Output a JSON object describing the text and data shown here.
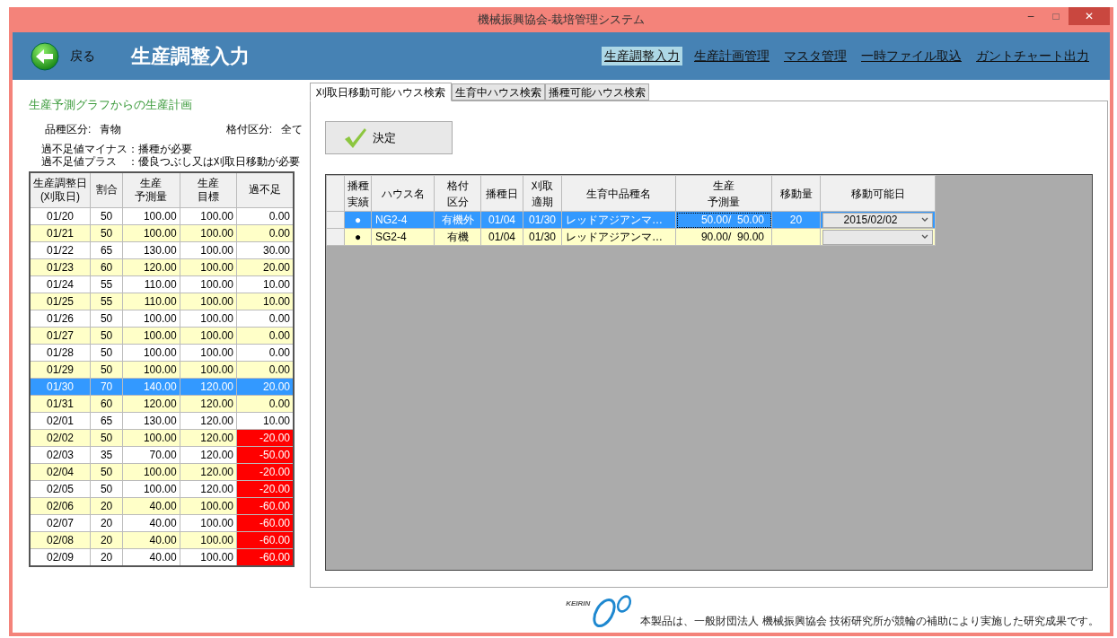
{
  "window": {
    "title": "機械振興協会-栽培管理システム",
    "controls": [
      "–",
      "□",
      "✕"
    ]
  },
  "header": {
    "back_label": "戻る",
    "title": "生産調整入力",
    "nav": [
      {
        "label": "生産調整入力",
        "selected": true
      },
      {
        "label": "生産計画管理",
        "selected": false
      },
      {
        "label": "マスタ管理",
        "selected": false
      },
      {
        "label": "一時ファイル取込",
        "selected": false
      },
      {
        "label": "ガントチャート出力",
        "selected": false
      }
    ]
  },
  "left_panel": {
    "heading": "生産予測グラフからの生産計画",
    "variety_label": "品種区分:",
    "variety_value": "青物",
    "grade_label": "格付区分:",
    "grade_value": "全て",
    "notes": [
      "過不足値マイナス：播種が必要",
      "過不足値プラス　：優良つぶし又は刈取日移動が必要"
    ],
    "table": {
      "columns": [
        {
          "line_1": "生産調整日",
          "line_2": "(刈取日)"
        },
        {
          "line_1": "割合"
        },
        {
          "line_1": "生産",
          "line_2": "予測量"
        },
        {
          "line_1": "生産",
          "line_2": "目標"
        },
        {
          "line_1": "過不足"
        }
      ],
      "rows": [
        {
          "cells": [
            "01/20",
            "50",
            "100.00",
            "100.00",
            "0.00"
          ],
          "selected": false,
          "shortage": false
        },
        {
          "cells": [
            "01/21",
            "50",
            "100.00",
            "100.00",
            "0.00"
          ],
          "selected": false,
          "shortage": false
        },
        {
          "cells": [
            "01/22",
            "65",
            "130.00",
            "100.00",
            "30.00"
          ],
          "selected": false,
          "shortage": false
        },
        {
          "cells": [
            "01/23",
            "60",
            "120.00",
            "100.00",
            "20.00"
          ],
          "selected": false,
          "shortage": false
        },
        {
          "cells": [
            "01/24",
            "55",
            "110.00",
            "100.00",
            "10.00"
          ],
          "selected": false,
          "shortage": false
        },
        {
          "cells": [
            "01/25",
            "55",
            "110.00",
            "100.00",
            "10.00"
          ],
          "selected": false,
          "shortage": false
        },
        {
          "cells": [
            "01/26",
            "50",
            "100.00",
            "100.00",
            "0.00"
          ],
          "selected": false,
          "shortage": false
        },
        {
          "cells": [
            "01/27",
            "50",
            "100.00",
            "100.00",
            "0.00"
          ],
          "selected": false,
          "shortage": false
        },
        {
          "cells": [
            "01/28",
            "50",
            "100.00",
            "100.00",
            "0.00"
          ],
          "selected": false,
          "shortage": false
        },
        {
          "cells": [
            "01/29",
            "50",
            "100.00",
            "100.00",
            "0.00"
          ],
          "selected": false,
          "shortage": false
        },
        {
          "cells": [
            "01/30",
            "70",
            "140.00",
            "120.00",
            "20.00"
          ],
          "selected": true,
          "shortage": false
        },
        {
          "cells": [
            "01/31",
            "60",
            "120.00",
            "120.00",
            "0.00"
          ],
          "selected": false,
          "shortage": false
        },
        {
          "cells": [
            "02/01",
            "65",
            "130.00",
            "120.00",
            "10.00"
          ],
          "selected": false,
          "shortage": false
        },
        {
          "cells": [
            "02/02",
            "50",
            "100.00",
            "120.00",
            "-20.00"
          ],
          "selected": false,
          "shortage": true
        },
        {
          "cells": [
            "02/03",
            "35",
            "70.00",
            "120.00",
            "-50.00"
          ],
          "selected": false,
          "shortage": true
        },
        {
          "cells": [
            "02/04",
            "50",
            "100.00",
            "120.00",
            "-20.00"
          ],
          "selected": false,
          "shortage": true
        },
        {
          "cells": [
            "02/05",
            "50",
            "100.00",
            "120.00",
            "-20.00"
          ],
          "selected": false,
          "shortage": true
        },
        {
          "cells": [
            "02/06",
            "20",
            "40.00",
            "100.00",
            "-60.00"
          ],
          "selected": false,
          "shortage": true
        },
        {
          "cells": [
            "02/07",
            "20",
            "40.00",
            "100.00",
            "-60.00"
          ],
          "selected": false,
          "shortage": true
        },
        {
          "cells": [
            "02/08",
            "20",
            "40.00",
            "100.00",
            "-60.00"
          ],
          "selected": false,
          "shortage": true
        },
        {
          "cells": [
            "02/09",
            "20",
            "40.00",
            "100.00",
            "-60.00"
          ],
          "selected": false,
          "shortage": true
        }
      ]
    }
  },
  "tabs": [
    {
      "label": "刈取日移動可能ハウス検索",
      "selected": true
    },
    {
      "label": "生育中ハウス検索",
      "selected": false
    },
    {
      "label": "播種可能ハウス検索",
      "selected": false
    }
  ],
  "decide_button": "決定",
  "grid": {
    "columns": [
      {
        "line_1": "播種",
        "line_2": "実績"
      },
      {
        "line_1": "ハウス名"
      },
      {
        "line_1": "格付",
        "line_2": "区分"
      },
      {
        "line_1": "播種日"
      },
      {
        "line_1": "刈取",
        "line_2": "適期"
      },
      {
        "line_1": "生育中品種名"
      },
      {
        "line_1": "生産",
        "line_2": "予測量"
      },
      {
        "line_1": "移動量"
      },
      {
        "line_1": "移動可能日"
      }
    ],
    "rows": [
      {
        "sown": "●",
        "house": "NG2-4",
        "grade": "有機外",
        "sow_date": "01/04",
        "harvest": "01/30",
        "variety": "レッドアジアンマ…",
        "forecast": "50.00/  50.00",
        "move_qty": "20",
        "move_date": "2015/02/02",
        "selected": true
      },
      {
        "sown": "●",
        "house": "SG2-4",
        "grade": "有機",
        "sow_date": "01/04",
        "harvest": "01/30",
        "variety": "レッドアジアンマ…",
        "forecast": "90.00/  90.00",
        "selected": false
      }
    ]
  },
  "footer": {
    "logo_text": "KEIRIN",
    "notice": "本製品は、一般財団法人 機械振興協会 技術研究所が競輪の補助により実施した研究成果です。"
  }
}
